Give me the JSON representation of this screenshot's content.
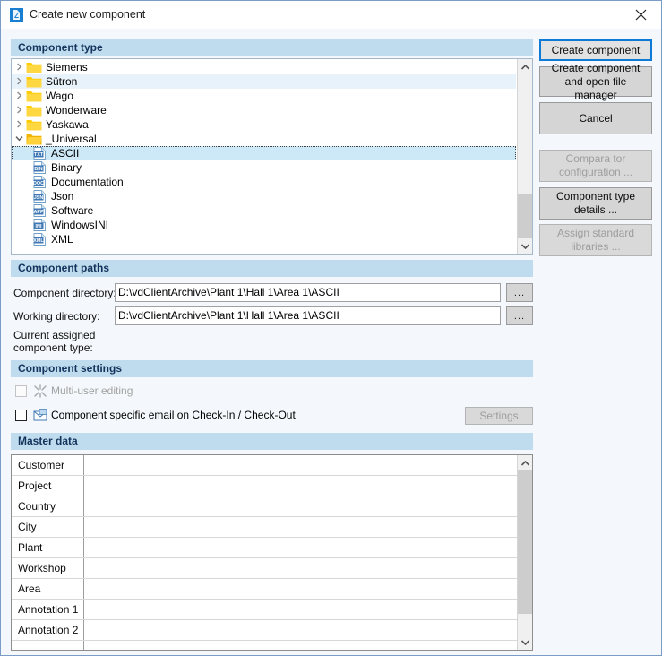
{
  "window": {
    "title": "Create new component",
    "icon": "app-icon",
    "close_label": "×"
  },
  "sections": {
    "component_type": "Component type",
    "component_paths": "Component paths",
    "component_settings": "Component settings",
    "master_data": "Master data"
  },
  "tree": {
    "items": [
      {
        "label": "Siemens",
        "kind": "folder",
        "expander": "collapsed",
        "depth": 0,
        "selected": false,
        "alt": false
      },
      {
        "label": "Sütron",
        "kind": "folder",
        "expander": "collapsed",
        "depth": 0,
        "selected": false,
        "alt": true
      },
      {
        "label": "Wago",
        "kind": "folder",
        "expander": "collapsed",
        "depth": 0,
        "selected": false,
        "alt": false
      },
      {
        "label": "Wonderware",
        "kind": "folder",
        "expander": "collapsed",
        "depth": 0,
        "selected": false,
        "alt": false
      },
      {
        "label": "Yaskawa",
        "kind": "folder",
        "expander": "collapsed",
        "depth": 0,
        "selected": false,
        "alt": false
      },
      {
        "label": "_Universal",
        "kind": "folder-open",
        "expander": "expanded",
        "depth": 0,
        "selected": false,
        "alt": false
      },
      {
        "label": "ASCII",
        "kind": "file",
        "badge": "TXT",
        "depth": 1,
        "selected": true,
        "alt": false
      },
      {
        "label": "Binary",
        "kind": "file",
        "badge": "BIN",
        "depth": 1,
        "selected": false,
        "alt": false
      },
      {
        "label": "Documentation",
        "kind": "file",
        "badge": "DOC",
        "depth": 1,
        "selected": false,
        "alt": false
      },
      {
        "label": "Json",
        "kind": "file",
        "badge": "JSN",
        "depth": 1,
        "selected": false,
        "alt": false
      },
      {
        "label": "Software",
        "kind": "file",
        "badge": "APP",
        "depth": 1,
        "selected": false,
        "alt": false
      },
      {
        "label": "WindowsINI",
        "kind": "file",
        "badge": "INI",
        "depth": 1,
        "selected": false,
        "alt": false
      },
      {
        "label": "XML",
        "kind": "file",
        "badge": "XML",
        "depth": 1,
        "selected": false,
        "alt": false
      }
    ]
  },
  "buttons": {
    "create_component": "Create component",
    "create_and_open": "Create component\nand open file manager",
    "cancel": "Cancel",
    "comparator_configuration": "Compara tor\nconfiguration ...",
    "component_type_details": "Component type\ndetails ...",
    "assign_standard_libraries": "Assign standard\nlibraries ...",
    "settings": "Settings",
    "browse": "..."
  },
  "paths": {
    "component_directory_label": "Component directory:",
    "component_directory_value": "D:\\vdClientArchive\\Plant 1\\Hall 1\\Area 1\\ASCII",
    "working_directory_label": "Working directory:",
    "working_directory_value": "D:\\vdClientArchive\\Plant 1\\Hall 1\\Area 1\\ASCII",
    "current_assigned_label_line1": "Current assigned",
    "current_assigned_label_line2": "component type:",
    "current_assigned_value": ""
  },
  "settings": {
    "multi_user_editing": "Multi-user editing",
    "multi_user_editing_checked": false,
    "multi_user_editing_enabled": false,
    "component_email": "Component specific email on Check-In / Check-Out",
    "component_email_checked": false
  },
  "master_data": {
    "rows": [
      {
        "label": "Customer",
        "value": ""
      },
      {
        "label": "Project",
        "value": ""
      },
      {
        "label": "Country",
        "value": ""
      },
      {
        "label": "City",
        "value": ""
      },
      {
        "label": "Plant",
        "value": ""
      },
      {
        "label": "Workshop",
        "value": ""
      },
      {
        "label": "Area",
        "value": ""
      },
      {
        "label": "Annotation 1",
        "value": ""
      },
      {
        "label": "Annotation 2",
        "value": ""
      },
      {
        "label": "",
        "value": ""
      }
    ]
  },
  "colors": {
    "section_header_bg": "#bfdcee",
    "section_header_text": "#13335c",
    "dialog_bg": "#f4f7fb",
    "selection_bg": "#cde8f7",
    "accent_focus": "#0f7ad6",
    "folder": "#ffcc00",
    "file_badge": "#3f78b5"
  }
}
